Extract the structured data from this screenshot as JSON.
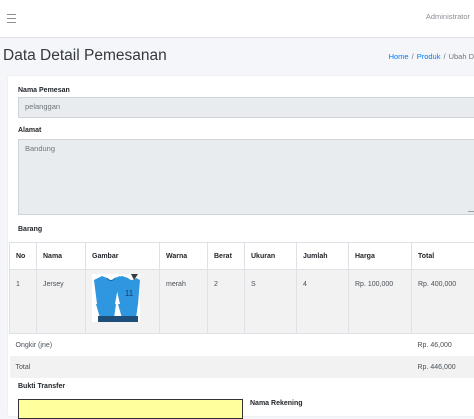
{
  "header": {
    "user": "Administrator"
  },
  "page": {
    "title": "Data Detail Pemesanan"
  },
  "breadcrumb": {
    "home": "Home",
    "produk": "Produk",
    "current": "Ubah D"
  },
  "form": {
    "nama_label": "Nama Pemesan",
    "nama_value": "pelanggan",
    "alamat_label": "Alamat",
    "alamat_value": "Bandung",
    "barang_label": "Barang",
    "bukti_label": "Bukti Transfer",
    "rekening_label": "Nama Rekening"
  },
  "table": {
    "headers": [
      "No",
      "Nama",
      "Gambar",
      "Warna",
      "Berat",
      "Ukuran",
      "Jumlah",
      "Harga",
      "Total"
    ],
    "rows": [
      {
        "no": "1",
        "nama": "Jersey",
        "gambar": "jersey-image",
        "warna": "merah",
        "berat": "2",
        "ukuran": "S",
        "jumlah": "4",
        "harga": "Rp. 100,000",
        "total": "Rp. 400,000"
      }
    ],
    "ongkir_label": "Ongkir (jne)",
    "ongkir_value": "Rp. 46,000",
    "total_label": "Total",
    "total_value": "Rp. 446,000"
  },
  "colors": {
    "accent": "#007bff",
    "jersey": "#2f97e0",
    "transfer_box": "#ffff9c"
  }
}
